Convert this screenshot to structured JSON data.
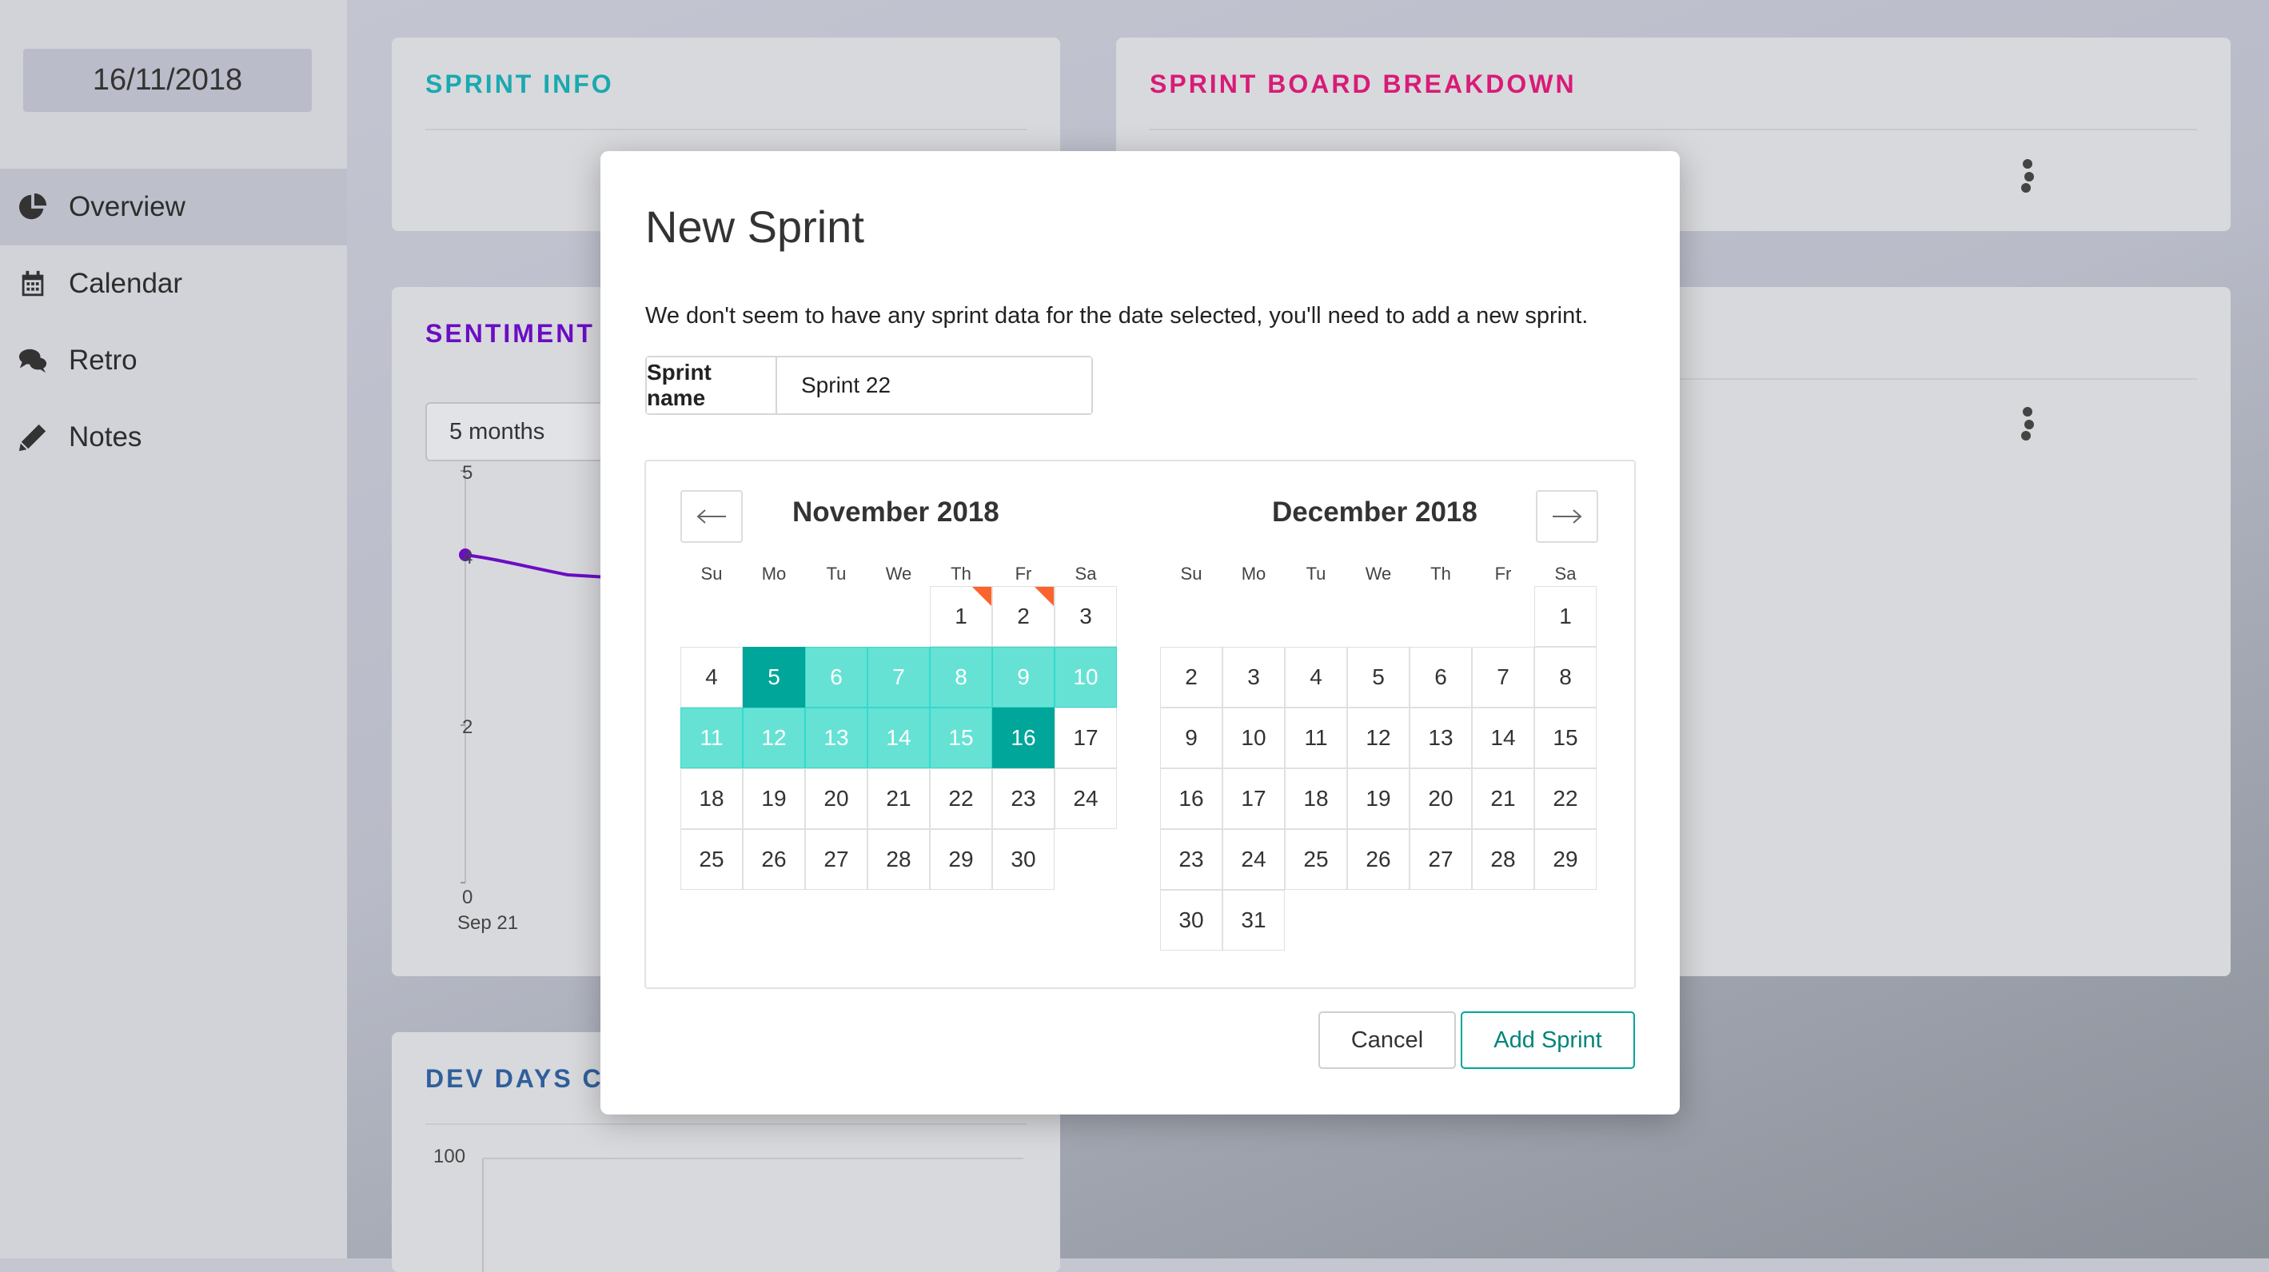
{
  "app": {
    "date": "16/11/2018",
    "nav": [
      {
        "label": "Overview",
        "icon": "pie-chart-icon",
        "active": true
      },
      {
        "label": "Calendar",
        "icon": "calendar-icon",
        "active": false
      },
      {
        "label": "Retro",
        "icon": "chat-bubbles-icon",
        "active": false
      },
      {
        "label": "Notes",
        "icon": "pencil-icon",
        "active": false
      }
    ]
  },
  "cards": {
    "sprint_info": {
      "title": "SPRINT INFO",
      "color": "#1aa9b0"
    },
    "board_breakdown": {
      "title": "SPRINT BOARD BREAKDOWN",
      "color": "#d81b78"
    },
    "sentiment": {
      "title": "SENTIMENT",
      "color": "#6a0dc4",
      "range_select": "5 months",
      "y_ticks": [
        "5",
        "4",
        "2",
        "0"
      ],
      "x_first_label": "Sep 21"
    },
    "dev_days": {
      "title": "DEV DAYS C",
      "color": "#2f5f9b",
      "y_tick": "100"
    }
  },
  "modal": {
    "title": "New Sprint",
    "message": "We don't seem to have any sprint data for the date selected, you'll need to add a new sprint.",
    "sprint_name_label": "Sprint name",
    "sprint_name_value": "Sprint 22",
    "weekdays": [
      "Su",
      "Mo",
      "Tu",
      "We",
      "Th",
      "Fr",
      "Sa"
    ],
    "months": [
      {
        "title": "November 2018",
        "first_weekday": 4,
        "days": 30,
        "range_start": 5,
        "range_end": 16,
        "marked": [
          1,
          2
        ]
      },
      {
        "title": "December 2018",
        "first_weekday": 6,
        "days": 31
      }
    ],
    "cancel_label": "Cancel",
    "add_label": "Add Sprint",
    "accent": "#00a699",
    "range_color": "#66e2d5",
    "marker_color": "#fc642d"
  }
}
